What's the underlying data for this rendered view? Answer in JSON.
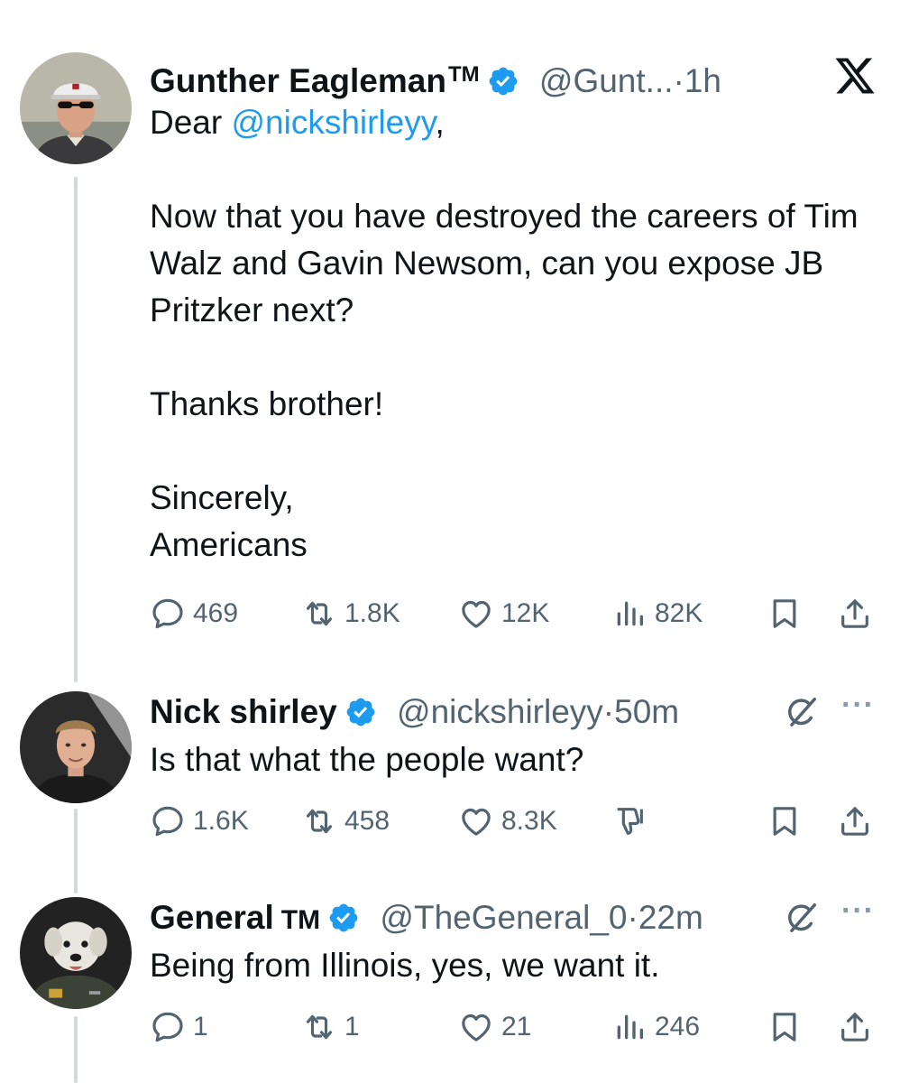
{
  "tweets": [
    {
      "name": "Gunther Eagleman",
      "tm": "TM",
      "handle": "@Gunt...",
      "dot": "·",
      "time": "1h",
      "body_prefix": "Dear ",
      "mention": "@nickshirleyy",
      "body_rest": ",\n\nNow that you have destroyed the careers of Tim Walz and Gavin Newsom, can you expose JB Pritzker next?\n\nThanks brother!\n\nSincerely,\nAmericans",
      "actions": {
        "replies": "469",
        "reposts": "1.8K",
        "likes": "12K",
        "views": "82K"
      },
      "avatar_icon": "profile-photo-man-cap-sunglasses"
    },
    {
      "name": "Nick shirley",
      "handle": "@nickshirleyy",
      "dot": "·",
      "time": "50m",
      "body": "Is that what the people want?",
      "actions": {
        "replies": "1.6K",
        "reposts": "458",
        "likes": "8.3K"
      },
      "avatar_icon": "profile-photo-young-man"
    },
    {
      "name": "General",
      "tm": "TM",
      "handle": "@TheGeneral_0",
      "dot": "·",
      "time": "22m",
      "body": "Being from Illinois, yes, we want it.",
      "actions": {
        "replies": "1",
        "reposts": "1",
        "likes": "21",
        "views": "246"
      },
      "avatar_icon": "profile-photo-dog-in-uniform"
    }
  ],
  "more_label": "···",
  "colors": {
    "accent": "#1d9bf0",
    "muted": "#536471",
    "thread_line": "#cfd9de",
    "text": "#0f1419"
  },
  "icons": [
    "x-logo-icon",
    "verified-badge-icon",
    "grok-icon",
    "reply-icon",
    "repost-icon",
    "like-icon",
    "views-icon",
    "downvote-icon",
    "bookmark-icon",
    "share-icon",
    "more-icon"
  ]
}
